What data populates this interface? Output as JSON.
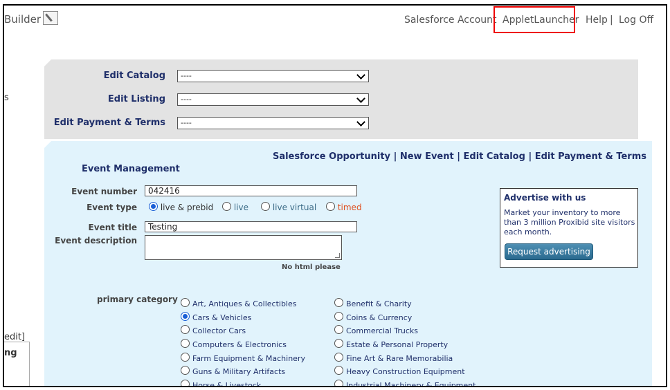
{
  "header": {
    "brand": "Builder",
    "nav": [
      "Salesforce Account",
      "AppletLauncher",
      "Help",
      "Log Off"
    ],
    "separator": "|"
  },
  "left_fragments": {
    "s": "s",
    "edit": "edit]",
    "ng": "ng"
  },
  "edit_panel": {
    "rows": [
      {
        "label": "Edit Catalog",
        "value": "----"
      },
      {
        "label": "Edit Listing",
        "value": "----"
      },
      {
        "label": "Edit Payment & Terms",
        "value": "----"
      }
    ]
  },
  "quicklinks": [
    "Salesforce Opportunity",
    "New Event",
    "Edit Catalog",
    "Edit Payment & Terms"
  ],
  "event_management": {
    "title": "Event Management",
    "event_number_label": "Event number",
    "event_number_value": "042416",
    "event_type_label": "Event type",
    "event_types": [
      "live & prebid",
      "live",
      "live virtual",
      "timed"
    ],
    "selected_event_type": "live & prebid",
    "event_title_label": "Event title",
    "event_title_value": "Testing",
    "event_description_label": "Event description",
    "no_html_note": "No html please"
  },
  "advertise": {
    "title": "Advertise with us",
    "text": "Market your inventory to more than 3 million Proxibid site visitors each month.",
    "button": "Request advertising"
  },
  "categories": {
    "label": "primary category",
    "left": [
      "Art, Antiques & Collectibles",
      "Cars & Vehicles",
      "Collector Cars",
      "Computers & Electronics",
      "Farm Equipment & Machinery",
      "Guns & Military Artifacts",
      "Horse & Livestock"
    ],
    "right": [
      "Benefit & Charity",
      "Coins & Currency",
      "Commercial Trucks",
      "Estate & Personal Property",
      "Fine Art & Rare Memorabilia",
      "Heavy Construction Equipment",
      "Industrial Machinery & Equipment"
    ],
    "selected": "Cars & Vehicles"
  },
  "colors": {
    "navy": "#1f2f6a",
    "highlight": "#e00000",
    "grey_panel": "#e3e3e3",
    "blue_panel": "#e1f3fc"
  }
}
